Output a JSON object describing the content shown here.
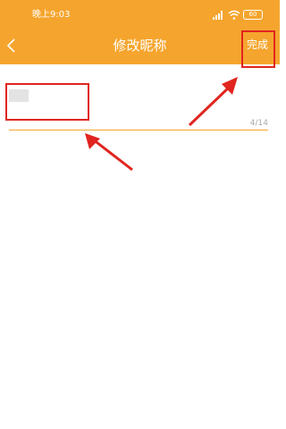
{
  "status_bar": {
    "time": "晚上9:03",
    "battery": "60"
  },
  "header": {
    "title": "修改昵称",
    "done_label": "完成",
    "background_color": "#f5a52e"
  },
  "nickname": {
    "counter": "4/14"
  },
  "icons": {
    "back": "chevron-left",
    "signal": "cellular-signal",
    "wifi": "wifi",
    "battery": "battery"
  },
  "colors": {
    "accent": "#f5a52e",
    "highlight": "#e0251f"
  }
}
